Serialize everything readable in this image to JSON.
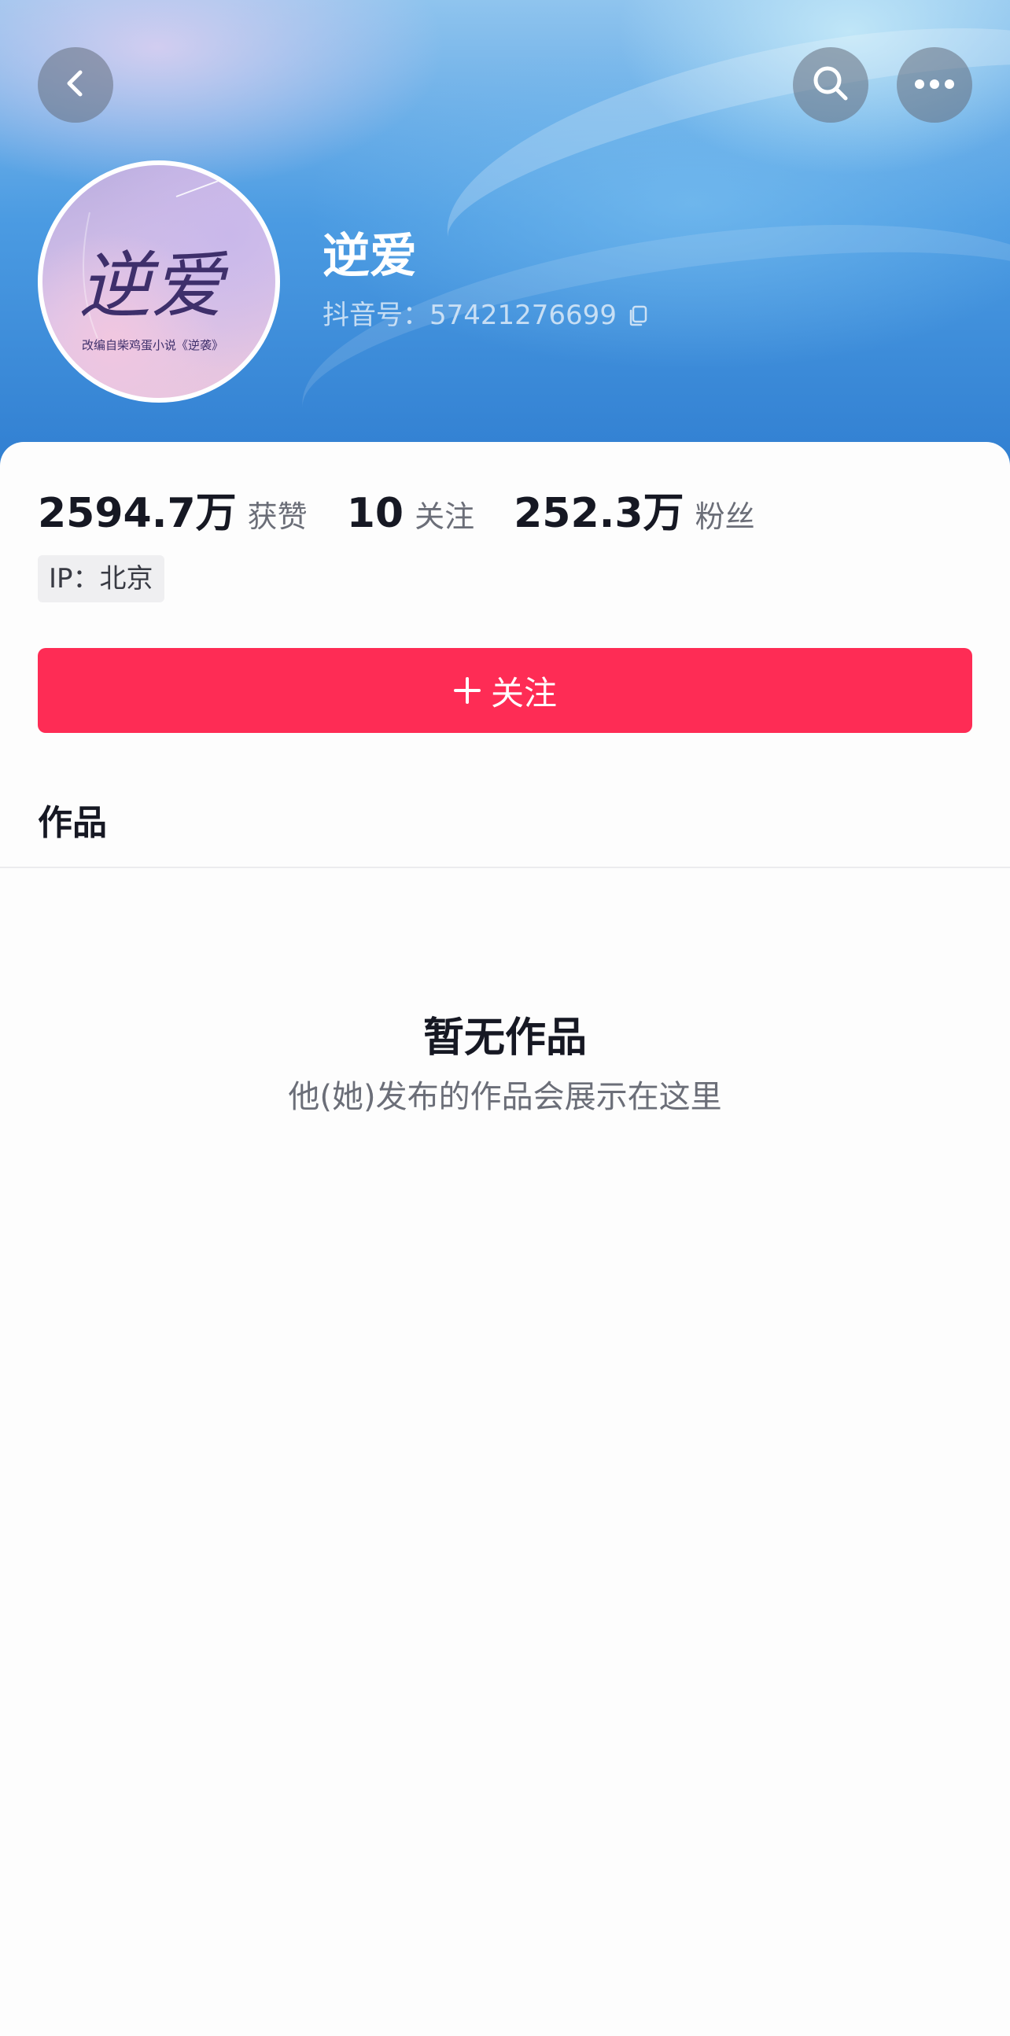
{
  "header": {
    "back_icon": "chevron-left-icon",
    "search_icon": "search-icon",
    "more_icon": "more-horizontal-icon"
  },
  "profile": {
    "name": "逆爱",
    "douyin_id_label": "抖音号：",
    "douyin_id": "57421276699",
    "avatar_title": "逆爱",
    "avatar_caption": "改编自柴鸡蛋小说《逆袭》"
  },
  "stats": [
    {
      "value": "2594.7万",
      "label": "获赞"
    },
    {
      "value": "10",
      "label": "关注"
    },
    {
      "value": "252.3万",
      "label": "粉丝"
    }
  ],
  "ip_tag": "IP：北京",
  "follow_button": "关注",
  "tabs": {
    "works": "作品"
  },
  "empty_state": {
    "title": "暂无作品",
    "subtitle": "他(她)发布的作品会展示在这里"
  },
  "colors": {
    "accent": "#fe2c55",
    "text_primary": "#161823",
    "text_secondary": "#6b6e78"
  }
}
